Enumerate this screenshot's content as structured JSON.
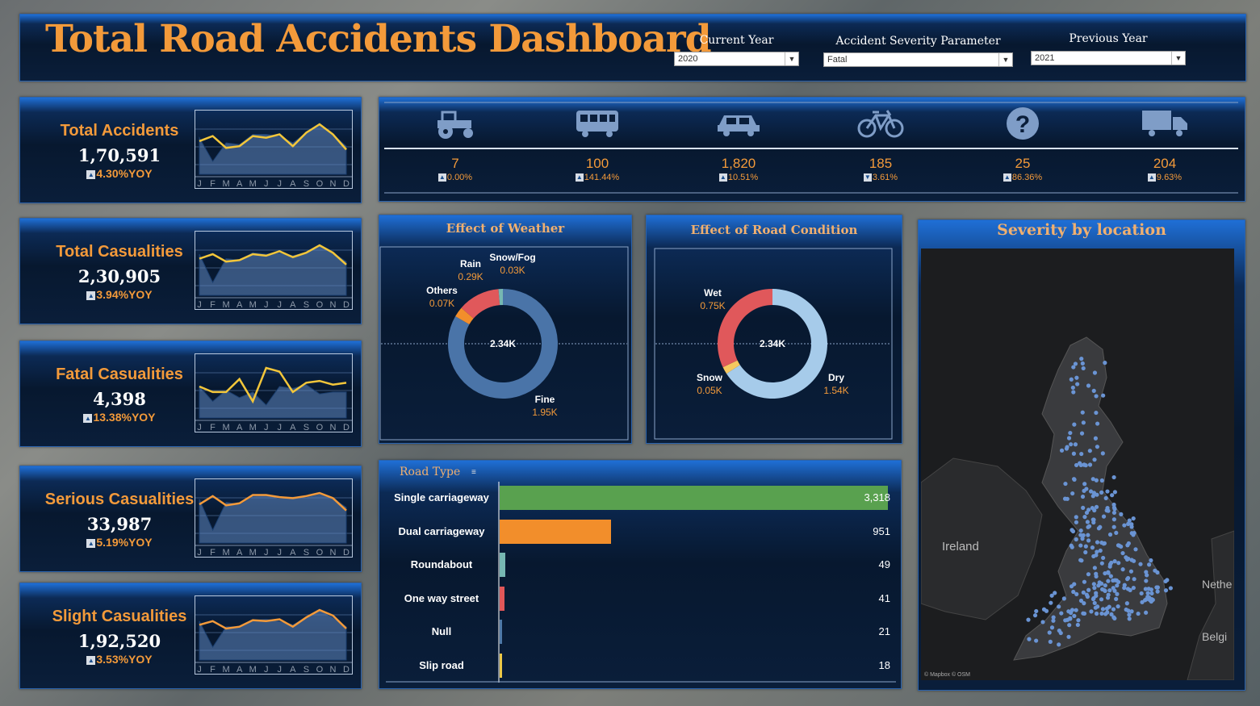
{
  "header": {
    "title": "Total Road Accidents Dashboard",
    "current_year_label": "Current Year",
    "current_year_value": "2020",
    "severity_label": "Accident Severity Parameter",
    "severity_value": "Fatal",
    "previous_year_label": "Previous Year",
    "previous_year_value": "2021"
  },
  "kpis": [
    {
      "label": "Total Accidents",
      "value": "1,70,591",
      "yoy": "4.30%YOY",
      "direction": "up"
    },
    {
      "label": "Total Casualities",
      "value": "2,30,905",
      "yoy": "3.94%YOY",
      "direction": "up"
    },
    {
      "label": "Fatal Casualities",
      "value": "4,398",
      "yoy": "13.38%YOY",
      "direction": "up"
    },
    {
      "label": "Serious Casualities",
      "value": "33,987",
      "yoy": "5.19%YOY",
      "direction": "up"
    },
    {
      "label": "Slight Casualities",
      "value": "1,92,520",
      "yoy": "3.53%YOY",
      "direction": "up"
    }
  ],
  "month_ticks": [
    "J",
    "F",
    "M",
    "A",
    "M",
    "J",
    "J",
    "A",
    "S",
    "O",
    "N",
    "D"
  ],
  "vehicles": [
    {
      "icon": "tractor-icon",
      "value": "7",
      "pct": "0.00%",
      "direction": "up"
    },
    {
      "icon": "bus-icon",
      "value": "100",
      "pct": "141.44%",
      "direction": "up"
    },
    {
      "icon": "car-icon",
      "value": "1,820",
      "pct": "10.51%",
      "direction": "up"
    },
    {
      "icon": "bicycle-icon",
      "value": "185",
      "pct": "3.61%",
      "direction": "down"
    },
    {
      "icon": "question-icon",
      "value": "25",
      "pct": "86.36%",
      "direction": "up"
    },
    {
      "icon": "truck-icon",
      "value": "204",
      "pct": "9.63%",
      "direction": "up"
    }
  ],
  "weather": {
    "title": "Effect of Weather",
    "center": "2.34K",
    "labels": [
      {
        "name": "Snow/Fog",
        "value": "0.03K"
      },
      {
        "name": "Rain",
        "value": "0.29K"
      },
      {
        "name": "Others",
        "value": "0.07K"
      },
      {
        "name": "Fine",
        "value": "1.95K"
      }
    ]
  },
  "road_condition": {
    "title": "Effect of Road Condition",
    "center": "2.34K",
    "labels": [
      {
        "name": "Wet",
        "value": "0.75K"
      },
      {
        "name": "Snow",
        "value": "0.05K"
      },
      {
        "name": "Dry",
        "value": "1.54K"
      }
    ]
  },
  "road_type": {
    "title": "Road Type",
    "rows": [
      {
        "label": "Single carriageway",
        "value": "3,318"
      },
      {
        "label": "Dual carriageway",
        "value": "951"
      },
      {
        "label": "Roundabout",
        "value": "49"
      },
      {
        "label": "One way street",
        "value": "41"
      },
      {
        "label": "Null",
        "value": "21"
      },
      {
        "label": "Slip road",
        "value": "18"
      }
    ]
  },
  "map": {
    "title": "Severity by location",
    "labels": [
      "Ireland",
      "Nethe",
      "Belgi"
    ],
    "attribution": "© Mapbox © OSM"
  },
  "colors": {
    "accent": "#f39a3a",
    "fine": "#4a74a8",
    "rain": "#e0585b",
    "others": "#f28e2b",
    "snow_fog": "#76b7b2",
    "dry": "#a6cbea",
    "wet": "#e0585b",
    "snow": "#f6c85f",
    "map_dot": "#6a94d4"
  },
  "chart_data": [
    {
      "type": "area",
      "title": "Total Accidents",
      "categories": [
        "J",
        "F",
        "M",
        "A",
        "M",
        "J",
        "J",
        "A",
        "S",
        "O",
        "N",
        "D"
      ],
      "series": [
        {
          "name": "Current Year",
          "values": [
            14.0,
            14.3,
            13.6,
            13.7,
            14.3,
            14.2,
            14.4,
            13.7,
            14.5,
            15.0,
            14.4,
            13.5
          ]
        },
        {
          "name": "Previous Year",
          "values": [
            14.2,
            12.8,
            13.9,
            13.8,
            14.4,
            14.4,
            14.3,
            13.9,
            14.5,
            15.0,
            14.4,
            13.7
          ]
        }
      ]
    },
    {
      "type": "area",
      "title": "Total Casualities",
      "categories": [
        "J",
        "F",
        "M",
        "A",
        "M",
        "J",
        "J",
        "A",
        "S",
        "O",
        "N",
        "D"
      ],
      "series": [
        {
          "name": "Current Year",
          "values": [
            19.5,
            19.8,
            19.3,
            19.4,
            19.8,
            19.7,
            20.0,
            19.6,
            19.9,
            20.4,
            19.9,
            19.1
          ]
        },
        {
          "name": "Previous Year",
          "values": [
            19.8,
            17.9,
            19.5,
            19.4,
            19.9,
            19.8,
            19.9,
            19.7,
            19.9,
            20.4,
            19.9,
            19.3
          ]
        }
      ]
    },
    {
      "type": "area",
      "title": "Fatal Casualities",
      "categories": [
        "J",
        "F",
        "M",
        "A",
        "M",
        "J",
        "J",
        "A",
        "S",
        "O",
        "N",
        "D"
      ],
      "series": [
        {
          "name": "Current Year",
          "values": [
            360,
            345,
            345,
            380,
            320,
            410,
            400,
            345,
            370,
            375,
            365,
            370
          ]
        },
        {
          "name": "Previous Year",
          "values": [
            360,
            320,
            350,
            330,
            345,
            310,
            360,
            355,
            365,
            340,
            345,
            345
          ]
        }
      ]
    },
    {
      "type": "area",
      "title": "Serious Casualities",
      "categories": [
        "J",
        "F",
        "M",
        "A",
        "M",
        "J",
        "J",
        "A",
        "S",
        "O",
        "N",
        "D"
      ],
      "series": [
        {
          "name": "Current Year",
          "values": [
            2900,
            2980,
            2890,
            2910,
            2990,
            2990,
            2970,
            2960,
            2980,
            3010,
            2960,
            2840
          ]
        },
        {
          "name": "Previous Year",
          "values": [
            2950,
            2650,
            2920,
            2900,
            2980,
            2990,
            2960,
            2970,
            2970,
            3000,
            2960,
            2870
          ]
        }
      ]
    },
    {
      "type": "area",
      "title": "Slight Casualities",
      "categories": [
        "J",
        "F",
        "M",
        "A",
        "M",
        "J",
        "J",
        "A",
        "S",
        "O",
        "N",
        "D"
      ],
      "series": [
        {
          "name": "Current Year",
          "values": [
            16200,
            16400,
            16000,
            16100,
            16450,
            16400,
            16500,
            16100,
            16600,
            17000,
            16700,
            16000
          ]
        },
        {
          "name": "Previous Year",
          "values": [
            16400,
            15000,
            16100,
            16100,
            16450,
            16500,
            16400,
            16200,
            16600,
            17000,
            16600,
            16100
          ]
        }
      ]
    },
    {
      "type": "pie",
      "title": "Effect of Weather",
      "categories": [
        "Fine",
        "Others",
        "Rain",
        "Snow/Fog"
      ],
      "values": [
        1.95,
        0.07,
        0.29,
        0.03
      ]
    },
    {
      "type": "pie",
      "title": "Effect of Road Condition",
      "categories": [
        "Dry",
        "Snow",
        "Wet"
      ],
      "values": [
        1.54,
        0.05,
        0.75
      ]
    },
    {
      "type": "bar",
      "title": "Road Type",
      "categories": [
        "Single carriageway",
        "Dual carriageway",
        "Roundabout",
        "One way street",
        "Null",
        "Slip road"
      ],
      "values": [
        3318,
        951,
        49,
        41,
        21,
        18
      ]
    }
  ]
}
